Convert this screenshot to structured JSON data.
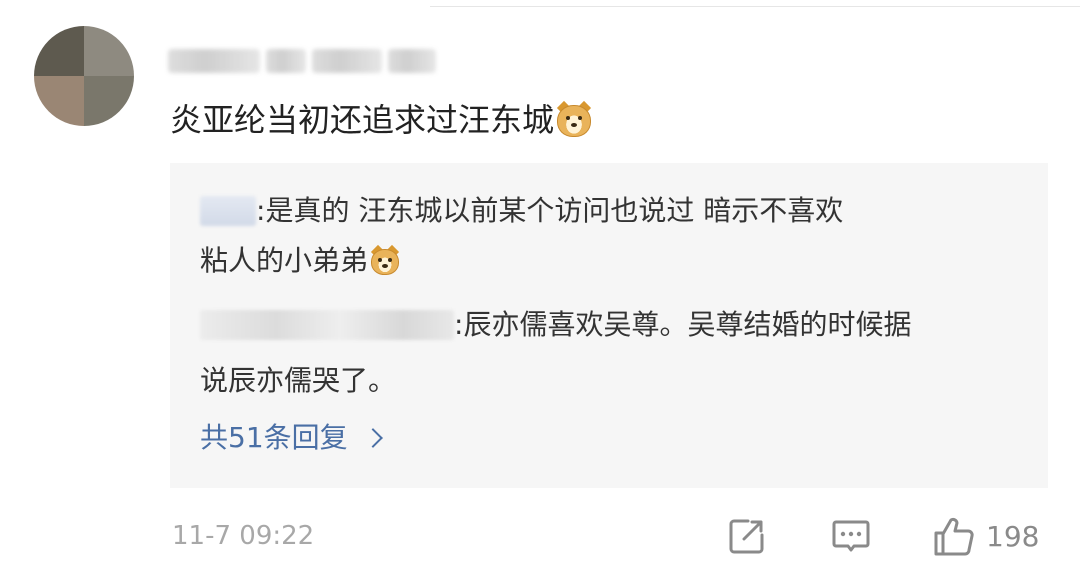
{
  "comment": {
    "text": "炎亚纶当初还追求过汪东城",
    "emoji_icon": "doge-emoji-icon",
    "timestamp": "11-7 09:22",
    "like_count": "198"
  },
  "replies": [
    {
      "separator": ":",
      "text_line1": " 是真的 汪东城以前某个访问也说过 暗示不喜欢",
      "text_line2": "粘人的小弟弟",
      "emoji_icon": "doge-emoji-icon"
    },
    {
      "separator": ":",
      "text_line1": " 辰亦儒喜欢吴尊。吴尊结婚的时候据",
      "text_line2": "说辰亦儒哭了。"
    }
  ],
  "view_more": {
    "label": "共51条回复"
  },
  "icons": {
    "share": "share-edit-icon",
    "comment": "comment-bubble-icon",
    "like": "thumbs-up-icon",
    "more": "chevron-right-icon"
  },
  "colors": {
    "link": "#4a6fa5",
    "reply_bg": "#f6f6f6",
    "meta": "#a8a8a8"
  }
}
